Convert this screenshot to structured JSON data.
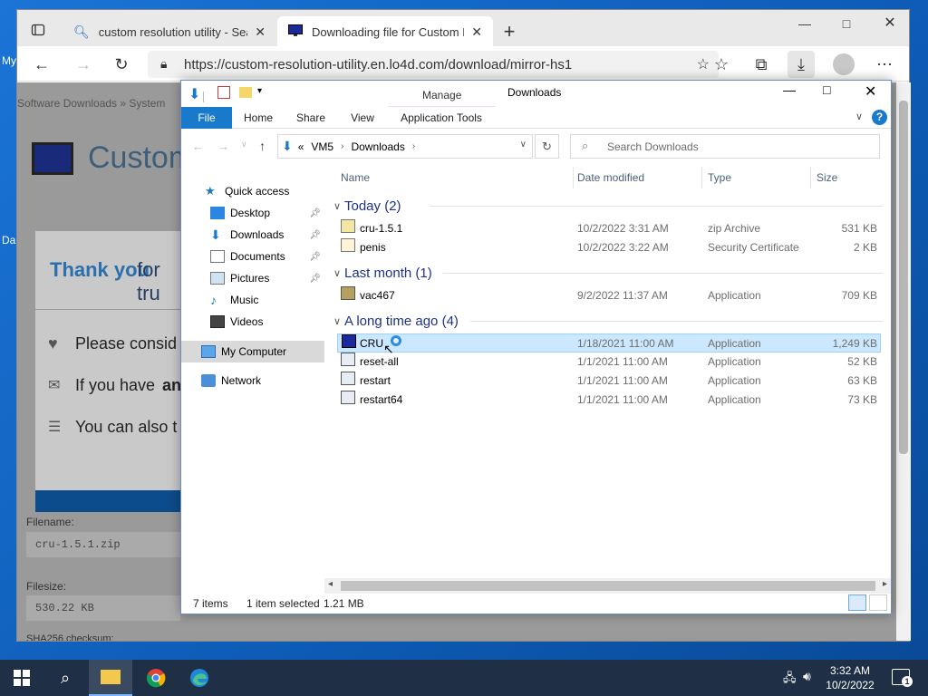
{
  "desktop": {
    "label1": "My",
    "label2": "Da"
  },
  "browser": {
    "tabs": [
      {
        "label": "custom resolution utility - Search",
        "close": "✕"
      },
      {
        "label": "Downloading file for Custom Res",
        "close": "✕"
      }
    ],
    "new_tab": "+",
    "url": "https://custom-resolution-utility.en.lo4d.com/download/mirror-hs1",
    "page": {
      "breadcrumb": "Software Downloads » System",
      "app_title": "Custom",
      "thank_you": "Thank you",
      "for_text": "for tru",
      "please": "Please consid",
      "if_you_have": "If you have",
      "if_bold": "an",
      "you_can": "You can also t",
      "filename_label": "Filename:",
      "filename_value": "cru-1.5.1.zip",
      "filesize_label": "Filesize:",
      "filesize_value": "530.22 KB",
      "sha_label": "SHA256 checksum:"
    }
  },
  "explorer": {
    "title": "Downloads",
    "manage": "Manage",
    "ribbon_tabs": [
      "File",
      "Home",
      "Share",
      "View",
      "Application Tools"
    ],
    "help": "?",
    "path": {
      "prefix": "«",
      "segments": [
        "VM5",
        "Downloads"
      ]
    },
    "search_placeholder": "Search Downloads",
    "nav": [
      {
        "label": "Quick access"
      },
      {
        "label": "Desktop"
      },
      {
        "label": "Downloads"
      },
      {
        "label": "Documents"
      },
      {
        "label": "Pictures"
      },
      {
        "label": "Music"
      },
      {
        "label": "Videos"
      },
      {
        "label": "My Computer"
      },
      {
        "label": "Network"
      }
    ],
    "columns": [
      "Name",
      "Date modified",
      "Type",
      "Size"
    ],
    "groups": [
      {
        "label": "Today (2)",
        "rows": [
          {
            "name": "cru-1.5.1",
            "date": "10/2/2022 3:31 AM",
            "type": "zip Archive",
            "size": "531 KB"
          },
          {
            "name": "penis",
            "date": "10/2/2022 3:22 AM",
            "type": "Security Certificate",
            "size": "2 KB"
          }
        ]
      },
      {
        "label": "Last month (1)",
        "rows": [
          {
            "name": "vac467",
            "date": "9/2/2022 11:37 AM",
            "type": "Application",
            "size": "709 KB"
          }
        ]
      },
      {
        "label": "A long time ago (4)",
        "rows": [
          {
            "name": "CRU",
            "date": "1/18/2021 11:00 AM",
            "type": "Application",
            "size": "1,249 KB"
          },
          {
            "name": "reset-all",
            "date": "1/1/2021 11:00 AM",
            "type": "Application",
            "size": "52 KB"
          },
          {
            "name": "restart",
            "date": "1/1/2021 11:00 AM",
            "type": "Application",
            "size": "63 KB"
          },
          {
            "name": "restart64",
            "date": "1/1/2021 11:00 AM",
            "type": "Application",
            "size": "73 KB"
          }
        ]
      }
    ],
    "status": {
      "items": "7 items",
      "selected": "1 item selected",
      "size": "1.21 MB"
    }
  },
  "taskbar": {
    "time": "3:32 AM",
    "date": "10/2/2022",
    "notif_count": "1"
  },
  "colors": {
    "accent": "#1979ca",
    "selected_row": "#cce8ff",
    "manage_band": "#f4d8f4",
    "taskbar": "#1f2f45"
  }
}
